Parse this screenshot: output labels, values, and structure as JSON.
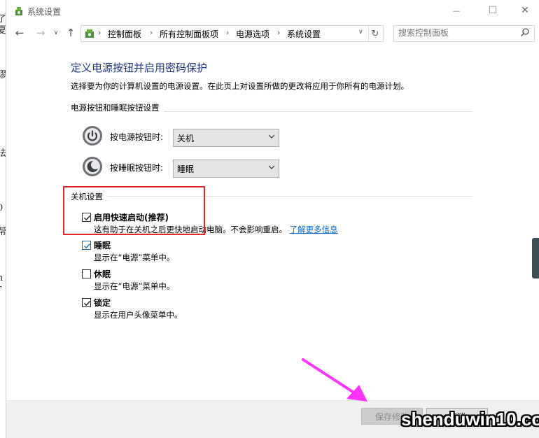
{
  "window": {
    "title": "系统设置"
  },
  "title_buttons": {
    "minimize": "—",
    "maximize": "☐",
    "close": "✕"
  },
  "nav": {
    "breadcrumbs": [
      "控制面板",
      "所有控制面板项",
      "电源选项",
      "系统设置"
    ],
    "search_placeholder": "搜索控制面板"
  },
  "page": {
    "title": "定义电源按钮并启用密码保护",
    "description": "选择要为你的计算机设置的电源设置。在此页上对设置所做的更改将应用于你所有的电源计划。",
    "section_buttons": "电源按钮和睡眠按钮设置",
    "power_button": {
      "label": "按电源按钮时:",
      "value": "关机"
    },
    "sleep_button": {
      "label": "按睡眠按钮时:",
      "value": "睡眠"
    },
    "section_shutdown": "关机设置",
    "options": [
      {
        "label": "启用快速启动(推荐)",
        "checked": true,
        "desc": "这有助于在关机之后更快地启动电脑。不会影响重启。",
        "link": "了解更多信息"
      },
      {
        "label": "睡眠",
        "checked": true,
        "desc": "显示在“电源”菜单中。"
      },
      {
        "label": "休眠",
        "checked": false,
        "desc": "显示在“电源”菜单中。"
      },
      {
        "label": "锁定",
        "checked": true,
        "desc": "显示在用户头像菜单中。"
      }
    ]
  },
  "footer": {
    "save": "保存修改",
    "cancel": "取消"
  },
  "watermark": "shenduwin10.com",
  "colors": {
    "title_blue": "#1e3287",
    "link_blue": "#0066cc",
    "highlight_red": "#e0282d",
    "arrow_magenta": "#ff33ff"
  }
}
